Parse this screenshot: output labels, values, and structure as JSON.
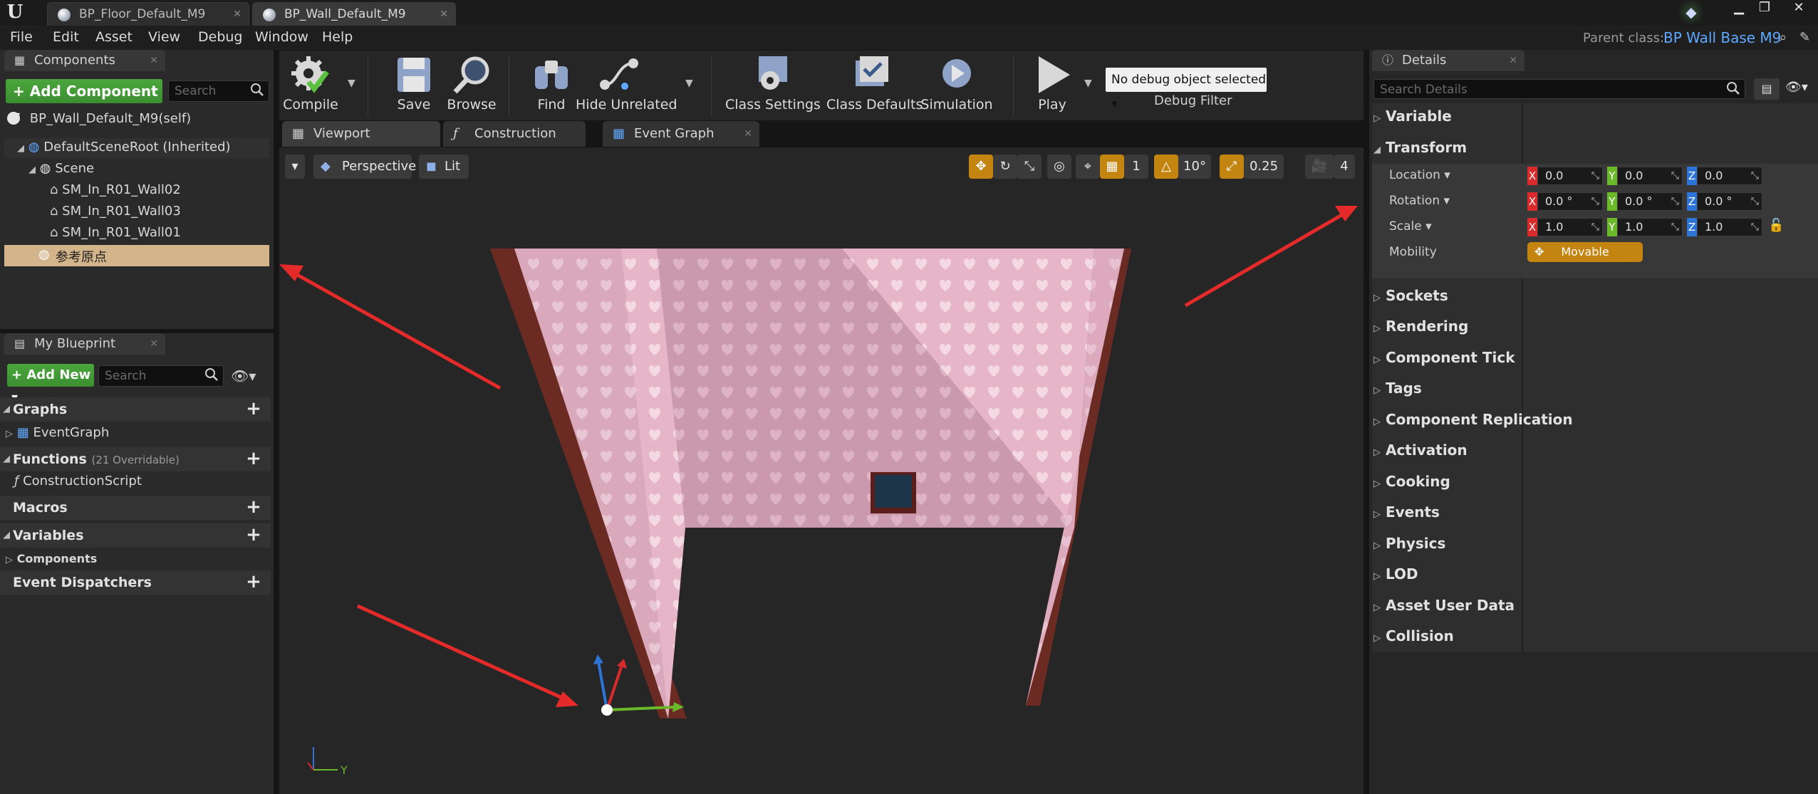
{
  "document_tabs": [
    {
      "label": "BP_Floor_Default_M9"
    },
    {
      "label": "BP_Wall_Default_M9"
    }
  ],
  "menu": [
    "File",
    "Edit",
    "Asset",
    "View",
    "Debug",
    "Window",
    "Help"
  ],
  "parent_class": {
    "label": "Parent class:",
    "value": "BP Wall Base M9"
  },
  "components_panel": {
    "tab_label": "Components",
    "add_button": "+ Add Component ▾",
    "search_placeholder": "Search",
    "self_item": "BP_Wall_Default_M9(self)",
    "tree": [
      "DefaultSceneRoot (Inherited)",
      "Scene",
      "SM_In_R01_Wall02",
      "SM_In_R01_Wall03",
      "SM_In_R01_Wall01",
      "参考原点"
    ]
  },
  "my_blueprint": {
    "tab_label": "My Blueprint",
    "add_new": "+ Add New ▾",
    "search_placeholder": "Search",
    "graphs_label": "Graphs",
    "event_graph": "EventGraph",
    "functions_label": "Functions",
    "functions_note": "(21 Overridable)",
    "construction_script": "ConstructionScript",
    "macros_label": "Macros",
    "variables_label": "Variables",
    "components_label": "Components",
    "event_dispatchers_label": "Event Dispatchers"
  },
  "toolbar": {
    "compile": "Compile",
    "save": "Save",
    "browse": "Browse",
    "find": "Find",
    "hide_unrelated": "Hide Unrelated",
    "class_settings": "Class Settings",
    "class_defaults": "Class Defaults",
    "simulation": "Simulation",
    "play": "Play",
    "debug_select": "No debug object selected ▾",
    "debug_filter": "Debug Filter"
  },
  "editor_tabs": [
    {
      "label": "Viewport"
    },
    {
      "label": "Construction Script"
    },
    {
      "label": "Event Graph"
    }
  ],
  "viewport": {
    "perspective": "Perspective",
    "lit": "Lit",
    "rotation_snap": "10°",
    "scale_snap": "0.25",
    "camera_speed": "4",
    "axis_y": "Y"
  },
  "details": {
    "tab_label": "Details",
    "search_placeholder": "Search Details",
    "sections_top": [
      "Variable",
      "Transform"
    ],
    "location_label": "Location",
    "rotation_label": "Rotation",
    "scale_label": "Scale",
    "mobility_label": "Mobility",
    "location": [
      "0.0",
      "0.0",
      "0.0"
    ],
    "rotation": [
      "0.0 °",
      "0.0 °",
      "0.0 °"
    ],
    "scale": [
      "1.0",
      "1.0",
      "1.0"
    ],
    "mobility_value": "Movable",
    "sections": [
      "Sockets",
      "Rendering",
      "Component Tick",
      "Tags",
      "Component Replication",
      "Activation",
      "Cooking",
      "Events",
      "Physics",
      "LOD",
      "Asset User Data",
      "Collision"
    ]
  },
  "colors": {
    "accent_green": "#3b8f30",
    "selection": "#d4b48a",
    "mobility": "#c48410",
    "axis_x": "#d92b2b",
    "axis_y": "#6bb82a",
    "axis_z": "#2e74d6",
    "annotation_arrow": "#e52a2a"
  }
}
